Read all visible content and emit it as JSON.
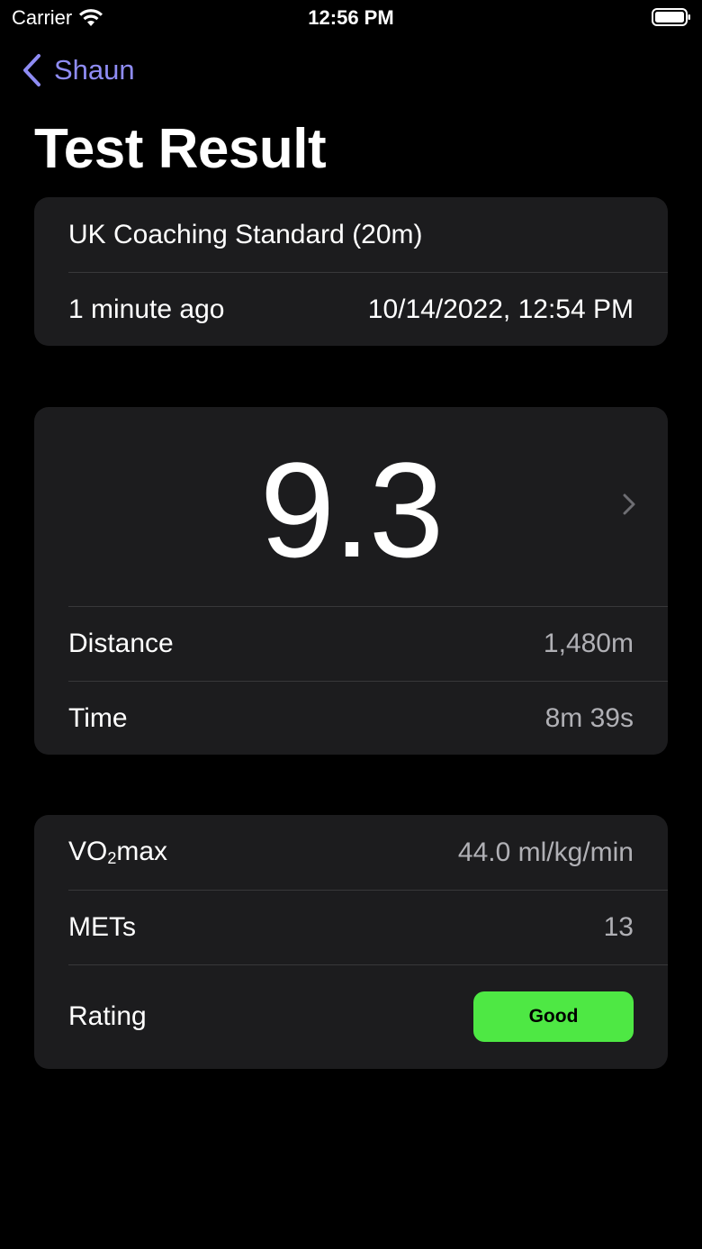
{
  "status_bar": {
    "carrier": "Carrier",
    "time": "12:56 PM"
  },
  "nav": {
    "back_label": "Shaun"
  },
  "page_title": "Test Result",
  "test_info": {
    "name": "UK Coaching Standard (20m)",
    "relative_time": "1 minute ago",
    "datetime": "10/14/2022, 12:54 PM"
  },
  "result": {
    "score": "9.3",
    "rows": [
      {
        "label": "Distance",
        "value": "1,480m"
      },
      {
        "label": "Time",
        "value": "8m 39s"
      }
    ]
  },
  "metrics": {
    "vo2_label_main": "VO",
    "vo2_label_sub": "2",
    "vo2_label_suffix": "max",
    "vo2_value": "44.0 ml/kg/min",
    "mets_label": "METs",
    "mets_value": "13",
    "rating_label": "Rating",
    "rating_value": "Good"
  },
  "colors": {
    "accent": "#8f8cf4",
    "rating_good": "#4ee844",
    "card_bg": "#1c1c1e"
  }
}
